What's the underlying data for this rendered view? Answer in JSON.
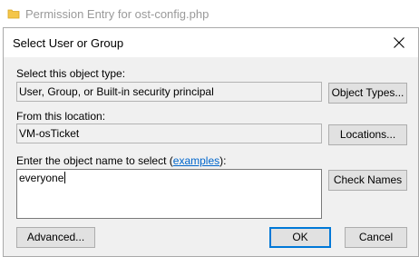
{
  "parent_window": {
    "title": "Permission Entry for ost-config.php",
    "icon": "folder-icon"
  },
  "dialog": {
    "title": "Select User or Group",
    "object_type": {
      "label": "Select this object type:",
      "value": "User, Group, or Built-in security principal",
      "button": "Object Types..."
    },
    "location": {
      "label": "From this location:",
      "value": "VM-osTicket",
      "button": "Locations..."
    },
    "object_name": {
      "label_prefix": "Enter the object name to select (",
      "label_link": "examples",
      "label_suffix": "):",
      "value": "everyone",
      "check_button": "Check Names"
    },
    "advanced_button": "Advanced...",
    "ok_button": "OK",
    "cancel_button": "Cancel"
  }
}
